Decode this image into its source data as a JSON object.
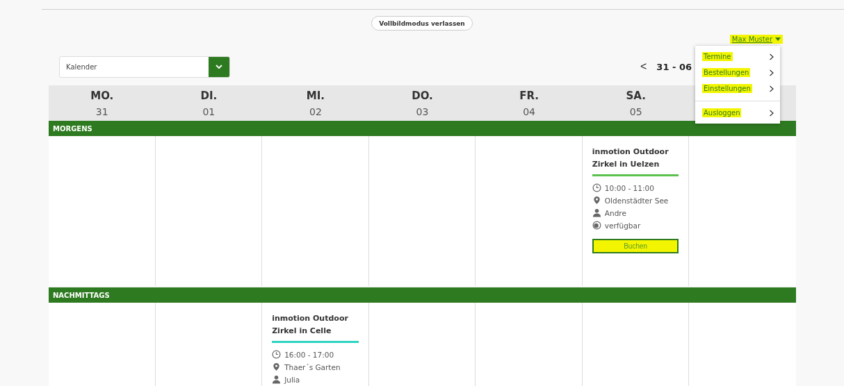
{
  "fullscreen_button": "Vollbildmodus verlassen",
  "user_menu": {
    "name": "Max Muster",
    "expanded": true,
    "highlighted": true,
    "items": [
      {
        "label": "Termine",
        "highlighted": true,
        "separated": false
      },
      {
        "label": "Bestellungen",
        "highlighted": true,
        "separated": false
      },
      {
        "label": "Einstellungen",
        "highlighted": true,
        "separated": false
      },
      {
        "label": "Ausloggen",
        "highlighted": true,
        "separated": true
      }
    ]
  },
  "calendar_select": {
    "value": "Kalender"
  },
  "range": {
    "prev": "<",
    "label": "31 - 06"
  },
  "days": [
    {
      "name": "MO.",
      "date": "31"
    },
    {
      "name": "DI.",
      "date": "01"
    },
    {
      "name": "MI.",
      "date": "02"
    },
    {
      "name": "DO.",
      "date": "03"
    },
    {
      "name": "FR.",
      "date": "04"
    },
    {
      "name": "SA.",
      "date": "05"
    }
  ],
  "sections": [
    {
      "title": "MORGENS",
      "cells": [
        {
          "kind": "empty"
        },
        {
          "kind": "empty"
        },
        {
          "kind": "empty"
        },
        {
          "kind": "empty"
        },
        {
          "kind": "empty"
        },
        {
          "kind": "event",
          "title": "inmotion Outdoor Zirkel in Uelzen",
          "color": "#5cc04e",
          "time": "10:00 - 11:00",
          "location": "Oldenstädter See",
          "person": "Andre",
          "availability": "verfügbar",
          "button": "Buchen",
          "button_highlighted": true
        },
        {
          "kind": "empty"
        }
      ]
    },
    {
      "title": "NACHMITTAGS",
      "cells": [
        {
          "kind": "empty"
        },
        {
          "kind": "empty"
        },
        {
          "kind": "event",
          "title": "inmotion Outdoor Zirkel in Celle",
          "color": "#2ed3c0",
          "time": "16:00 - 17:00",
          "location": "Thaer´s Garten",
          "person": "Julia"
        },
        {
          "kind": "empty"
        },
        {
          "kind": "empty"
        },
        {
          "kind": "empty"
        },
        {
          "kind": "empty"
        }
      ]
    }
  ]
}
